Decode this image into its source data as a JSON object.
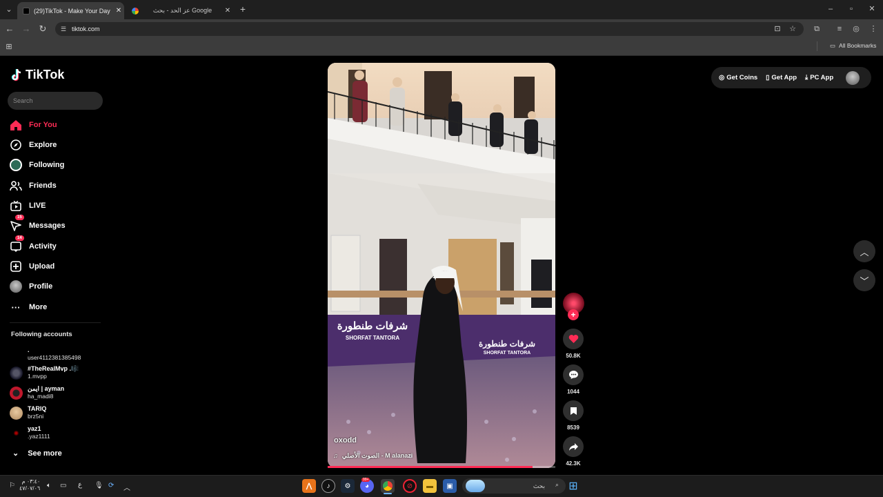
{
  "browser": {
    "tabs": [
      {
        "title": "(29)TikTok - Make Your Day"
      },
      {
        "title": "عز الحد - بحث Google"
      }
    ],
    "url": "tiktok.com",
    "bookmarks_label": "All Bookmarks"
  },
  "sidebar": {
    "logo": "TikTok",
    "search_placeholder": "Search",
    "nav": [
      {
        "label": "For You",
        "icon": "home-icon",
        "active": true
      },
      {
        "label": "Explore",
        "icon": "compass-icon"
      },
      {
        "label": "Following",
        "icon": "following-avatar-icon"
      },
      {
        "label": "Friends",
        "icon": "friends-icon"
      },
      {
        "label": "LIVE",
        "icon": "live-icon"
      },
      {
        "label": "Messages",
        "icon": "messages-icon",
        "badge": "15"
      },
      {
        "label": "Activity",
        "icon": "activity-icon",
        "badge": "14"
      },
      {
        "label": "Upload",
        "icon": "upload-icon"
      },
      {
        "label": "Profile",
        "icon": "profile-avatar-icon"
      },
      {
        "label": "More",
        "icon": "more-icon"
      }
    ],
    "following_heading": "Following accounts",
    "accounts": [
      {
        "name": ".",
        "handle": "user4112381385498"
      },
      {
        "name": "#TheRealMvp .🎼",
        "handle": "1.mvpp"
      },
      {
        "name": "ايمن | ayman",
        "handle": "ha_madi8"
      },
      {
        "name": "TARIQ",
        "handle": "brz5ni"
      },
      {
        "name": "yaz1",
        "handle": ".yaz1111"
      }
    ],
    "see_more": "See more"
  },
  "video": {
    "author": "oxodd",
    "sound": "الصوت الأصلي - M alanazi",
    "banner_arabic": "شرفات طنطورة",
    "banner_english": "SHORFAT TANTORA",
    "progress": 0.9
  },
  "actions": {
    "likes": "50.8K",
    "comments": "1044",
    "saves": "8539",
    "shares": "42.3K"
  },
  "top_right": {
    "get_coins": "Get Coins",
    "get_app": "Get App",
    "pc_app": "PC App"
  },
  "taskbar": {
    "time": "٠٣:٤٠ م",
    "date": "٤٧/٠٧/٠٦",
    "lang": "ع",
    "search_placeholder": "بحث",
    "discord_badge": "99+"
  },
  "colors": {
    "accent": "#fe2c55"
  }
}
